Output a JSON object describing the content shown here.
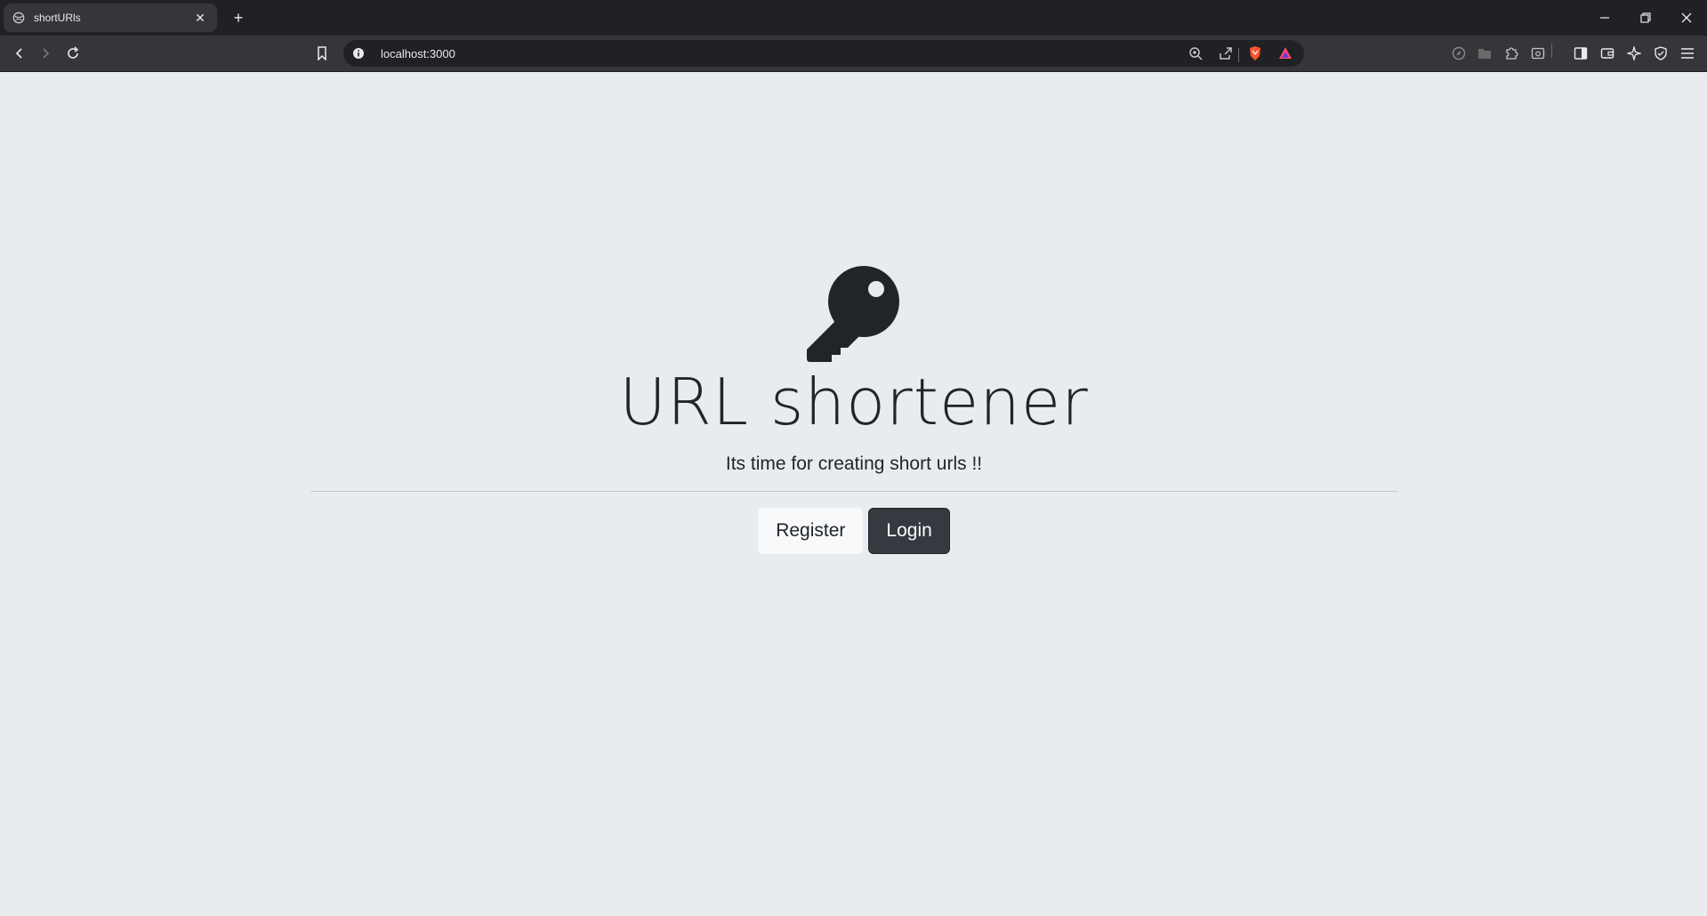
{
  "browser": {
    "tab_title": "shortURls",
    "tab_close": "✕",
    "new_tab": "+",
    "url": "localhost:3000",
    "window_controls": {
      "minimize": "–",
      "restore": "❐",
      "close": "✕"
    }
  },
  "hero": {
    "icon": "key-icon",
    "title": "URL shortener",
    "lead": "Its time for creating short urls !!",
    "register_label": "Register",
    "login_label": "Login"
  },
  "colors": {
    "page_bg": "#e9ecef",
    "text": "#212529",
    "btn_light": "#f8f9fa",
    "btn_dark": "#343a40"
  }
}
